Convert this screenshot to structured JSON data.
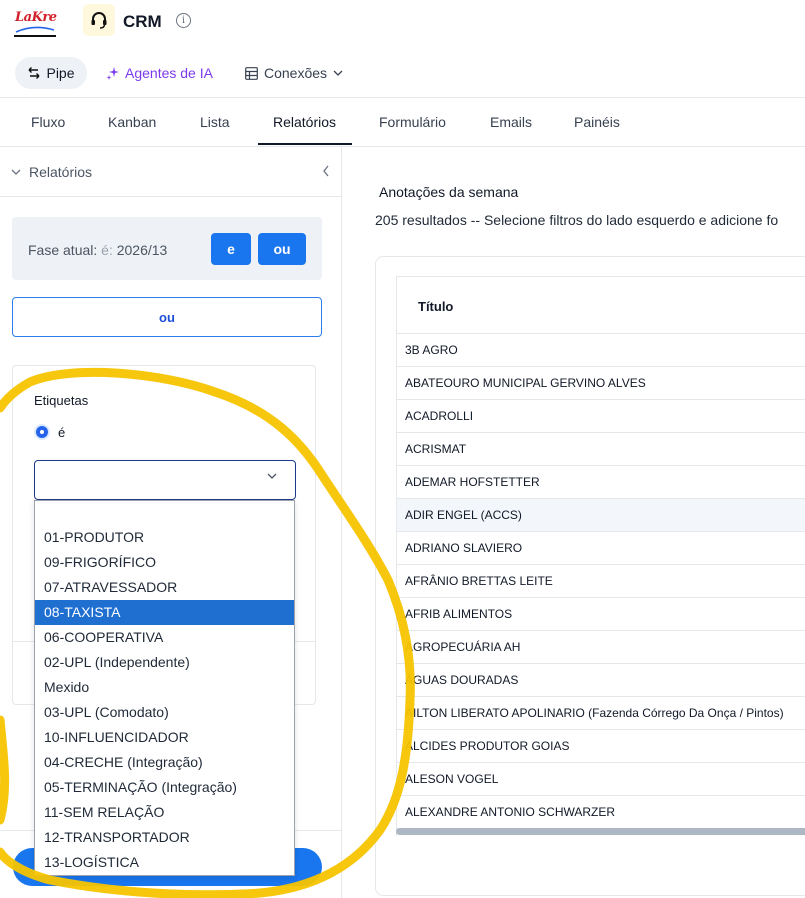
{
  "header": {
    "logo_text": "LaKre",
    "app_title": "CRM",
    "info_icon": "info-icon"
  },
  "subnav": {
    "pipe_label": "Pipe",
    "agentes_label": "Agentes de IA",
    "conexoes_label": "Conexões"
  },
  "tabs": [
    {
      "label": "Fluxo"
    },
    {
      "label": "Kanban"
    },
    {
      "label": "Lista"
    },
    {
      "label": "Relatórios",
      "active": true
    },
    {
      "label": "Formulário"
    },
    {
      "label": "Emails"
    },
    {
      "label": "Painéis"
    }
  ],
  "sidebar": {
    "title": "Relatórios",
    "fase_label": "Fase atual:",
    "fase_op": "é:",
    "fase_value": "2026/13",
    "btn_e": "e",
    "btn_ou": "ou",
    "ou_outline": "ou",
    "etiquetas_label": "Etiquetas",
    "radio_label": "é",
    "select_value": "",
    "options": [
      "01-PRODUTOR",
      "09-FRIGORÍFICO",
      "07-ATRAVESSADOR",
      "08-TAXISTA",
      "06-COOPERATIVA",
      "02-UPL (Independente)",
      "Mexido",
      "03-UPL (Comodato)",
      "10-INFLUENCIDADOR",
      "04-CRECHE (Integração)",
      "05-TERMINAÇÃO (Integração)",
      "11-SEM RELAÇÃO",
      "12-TRANSPORTADOR",
      "13-LOGÍSTICA"
    ],
    "selected_option": "08-TAXISTA"
  },
  "main": {
    "title": "Anotações da semana",
    "results_text": "205 resultados -- Selecione filtros do lado esquerdo e adicione fo",
    "column_header": "Título",
    "rows": [
      "3B AGRO",
      "ABATEOURO MUNICIPAL GERVINO ALVES",
      "ACADROLLI",
      "ACRISMAT",
      "ADEMAR HOFSTETTER",
      "ADIR ENGEL (ACCS)",
      "ADRIANO SLAVIERO",
      "AFRÂNIO BRETTAS LEITE",
      "AFRIB ALIMENTOS",
      "AGROPECUÁRIA AH",
      "ÁGUAS DOURADAS",
      "AILTON LIBERATO APOLINARIO (Fazenda Córrego Da Onça / Pintos)",
      "ALCIDES PRODUTOR GOIAS",
      "ALESON VOGEL",
      "ALEXANDRE ANTONIO SCHWARZER"
    ],
    "highlight_row": 5
  },
  "colors": {
    "accent": "#1976ee",
    "selected_option": "#1f6fd1",
    "agentes": "#7c3aed",
    "annotation": "#f5c400"
  }
}
